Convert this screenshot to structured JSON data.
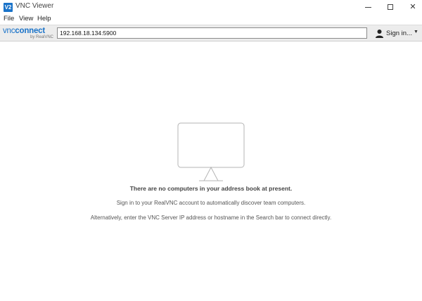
{
  "window": {
    "title": "VNC Viewer",
    "app_icon_text": "V2",
    "controls": {
      "minimize_icon": "minimize-icon",
      "maximize_icon": "maximize-icon",
      "close_icon": "close-icon",
      "close_glyph": "✕"
    }
  },
  "menu": {
    "items": [
      {
        "label": "File"
      },
      {
        "label": "View"
      },
      {
        "label": "Help"
      }
    ]
  },
  "toolbar": {
    "logo_main_vnc": "vnc",
    "logo_main_connect": "connect",
    "logo_sub": "by RealVNC",
    "address_value": "192.168.18.134:5900",
    "signin_label": "Sign in...",
    "signin_caret": "▼",
    "accent_color": "#1a73c9"
  },
  "empty_state": {
    "illustration": "monitor-icon",
    "title": "There are no computers in your address book at present.",
    "signin_hint": "Sign in to your RealVNC account to automatically discover team computers.",
    "alt_hint": "Alternatively, enter the VNC Server IP address or hostname in the Search bar to connect directly."
  }
}
